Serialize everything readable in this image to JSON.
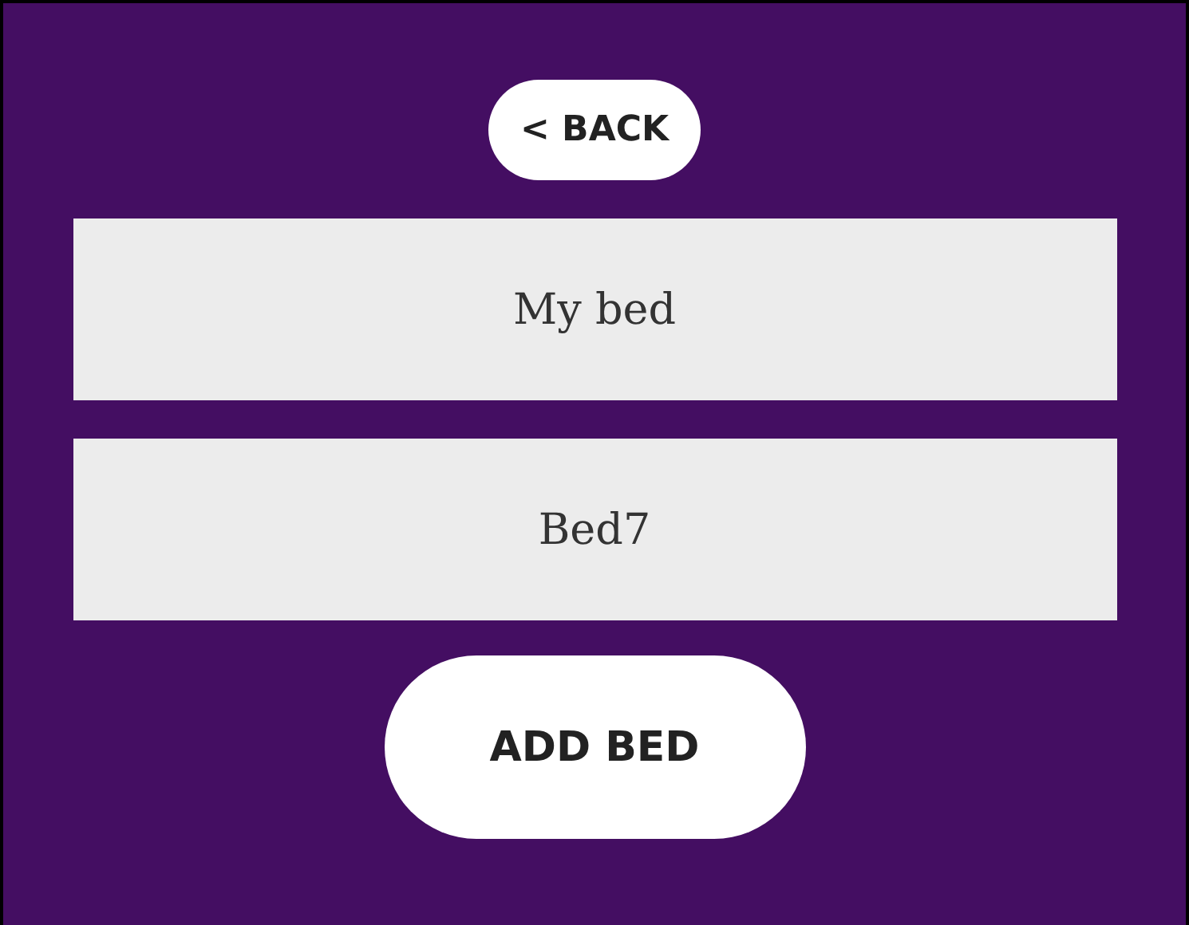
{
  "back_button": {
    "label": "< BACK"
  },
  "beds": [
    {
      "name": "My bed"
    },
    {
      "name": "Bed7"
    }
  ],
  "add_button": {
    "label": "ADD BED"
  }
}
